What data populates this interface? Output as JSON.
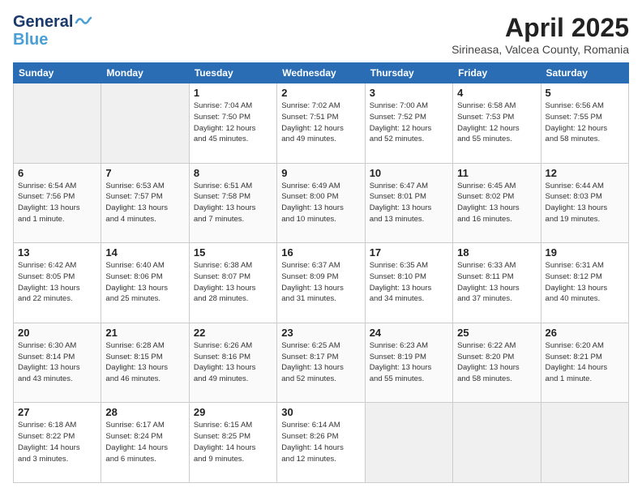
{
  "header": {
    "logo_line1": "General",
    "logo_line2": "Blue",
    "month_title": "April 2025",
    "location": "Sirineasa, Valcea County, Romania"
  },
  "days_of_week": [
    "Sunday",
    "Monday",
    "Tuesday",
    "Wednesday",
    "Thursday",
    "Friday",
    "Saturday"
  ],
  "weeks": [
    [
      {
        "day": "",
        "info": ""
      },
      {
        "day": "",
        "info": ""
      },
      {
        "day": "1",
        "info": "Sunrise: 7:04 AM\nSunset: 7:50 PM\nDaylight: 12 hours\nand 45 minutes."
      },
      {
        "day": "2",
        "info": "Sunrise: 7:02 AM\nSunset: 7:51 PM\nDaylight: 12 hours\nand 49 minutes."
      },
      {
        "day": "3",
        "info": "Sunrise: 7:00 AM\nSunset: 7:52 PM\nDaylight: 12 hours\nand 52 minutes."
      },
      {
        "day": "4",
        "info": "Sunrise: 6:58 AM\nSunset: 7:53 PM\nDaylight: 12 hours\nand 55 minutes."
      },
      {
        "day": "5",
        "info": "Sunrise: 6:56 AM\nSunset: 7:55 PM\nDaylight: 12 hours\nand 58 minutes."
      }
    ],
    [
      {
        "day": "6",
        "info": "Sunrise: 6:54 AM\nSunset: 7:56 PM\nDaylight: 13 hours\nand 1 minute."
      },
      {
        "day": "7",
        "info": "Sunrise: 6:53 AM\nSunset: 7:57 PM\nDaylight: 13 hours\nand 4 minutes."
      },
      {
        "day": "8",
        "info": "Sunrise: 6:51 AM\nSunset: 7:58 PM\nDaylight: 13 hours\nand 7 minutes."
      },
      {
        "day": "9",
        "info": "Sunrise: 6:49 AM\nSunset: 8:00 PM\nDaylight: 13 hours\nand 10 minutes."
      },
      {
        "day": "10",
        "info": "Sunrise: 6:47 AM\nSunset: 8:01 PM\nDaylight: 13 hours\nand 13 minutes."
      },
      {
        "day": "11",
        "info": "Sunrise: 6:45 AM\nSunset: 8:02 PM\nDaylight: 13 hours\nand 16 minutes."
      },
      {
        "day": "12",
        "info": "Sunrise: 6:44 AM\nSunset: 8:03 PM\nDaylight: 13 hours\nand 19 minutes."
      }
    ],
    [
      {
        "day": "13",
        "info": "Sunrise: 6:42 AM\nSunset: 8:05 PM\nDaylight: 13 hours\nand 22 minutes."
      },
      {
        "day": "14",
        "info": "Sunrise: 6:40 AM\nSunset: 8:06 PM\nDaylight: 13 hours\nand 25 minutes."
      },
      {
        "day": "15",
        "info": "Sunrise: 6:38 AM\nSunset: 8:07 PM\nDaylight: 13 hours\nand 28 minutes."
      },
      {
        "day": "16",
        "info": "Sunrise: 6:37 AM\nSunset: 8:09 PM\nDaylight: 13 hours\nand 31 minutes."
      },
      {
        "day": "17",
        "info": "Sunrise: 6:35 AM\nSunset: 8:10 PM\nDaylight: 13 hours\nand 34 minutes."
      },
      {
        "day": "18",
        "info": "Sunrise: 6:33 AM\nSunset: 8:11 PM\nDaylight: 13 hours\nand 37 minutes."
      },
      {
        "day": "19",
        "info": "Sunrise: 6:31 AM\nSunset: 8:12 PM\nDaylight: 13 hours\nand 40 minutes."
      }
    ],
    [
      {
        "day": "20",
        "info": "Sunrise: 6:30 AM\nSunset: 8:14 PM\nDaylight: 13 hours\nand 43 minutes."
      },
      {
        "day": "21",
        "info": "Sunrise: 6:28 AM\nSunset: 8:15 PM\nDaylight: 13 hours\nand 46 minutes."
      },
      {
        "day": "22",
        "info": "Sunrise: 6:26 AM\nSunset: 8:16 PM\nDaylight: 13 hours\nand 49 minutes."
      },
      {
        "day": "23",
        "info": "Sunrise: 6:25 AM\nSunset: 8:17 PM\nDaylight: 13 hours\nand 52 minutes."
      },
      {
        "day": "24",
        "info": "Sunrise: 6:23 AM\nSunset: 8:19 PM\nDaylight: 13 hours\nand 55 minutes."
      },
      {
        "day": "25",
        "info": "Sunrise: 6:22 AM\nSunset: 8:20 PM\nDaylight: 13 hours\nand 58 minutes."
      },
      {
        "day": "26",
        "info": "Sunrise: 6:20 AM\nSunset: 8:21 PM\nDaylight: 14 hours\nand 1 minute."
      }
    ],
    [
      {
        "day": "27",
        "info": "Sunrise: 6:18 AM\nSunset: 8:22 PM\nDaylight: 14 hours\nand 3 minutes."
      },
      {
        "day": "28",
        "info": "Sunrise: 6:17 AM\nSunset: 8:24 PM\nDaylight: 14 hours\nand 6 minutes."
      },
      {
        "day": "29",
        "info": "Sunrise: 6:15 AM\nSunset: 8:25 PM\nDaylight: 14 hours\nand 9 minutes."
      },
      {
        "day": "30",
        "info": "Sunrise: 6:14 AM\nSunset: 8:26 PM\nDaylight: 14 hours\nand 12 minutes."
      },
      {
        "day": "",
        "info": ""
      },
      {
        "day": "",
        "info": ""
      },
      {
        "day": "",
        "info": ""
      }
    ]
  ]
}
